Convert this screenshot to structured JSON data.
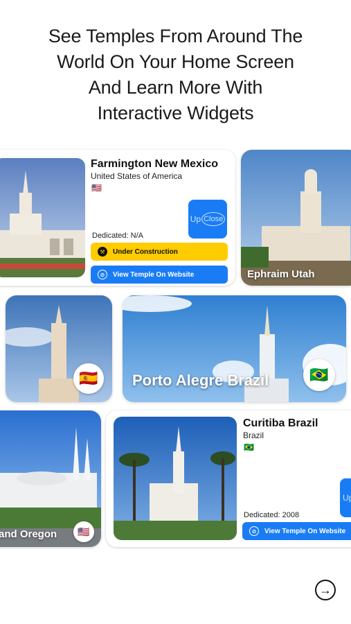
{
  "headline": {
    "line1": "See Temples From Around The",
    "line2": "World On Your Home Screen",
    "line3": "And Learn More With",
    "line4": "Interactive Widgets"
  },
  "widgets": {
    "farmington": {
      "title": "Farmington New Mexico",
      "country": "United States of America",
      "flag": "🇺🇸",
      "upclose_up": "Up",
      "upclose_close": "Close",
      "dedicated": "Dedicated: N/A",
      "status_label": "Under Construction",
      "status_icon": "hammer-icon",
      "website_label": "View Temple On Website",
      "website_icon": "globe-icon"
    },
    "ephraim": {
      "name": "Ephraim Utah"
    },
    "spain": {
      "flag": "🇪🇸"
    },
    "porto_alegre": {
      "name": "Porto Alegre Brazil",
      "flag": "🇧🇷"
    },
    "oregon": {
      "name": "and Oregon",
      "flag": "🇺🇸"
    },
    "curitiba": {
      "title": "Curitiba Brazil",
      "country": "Brazil",
      "flag": "🇧🇷",
      "upclose_up": "Up",
      "dedicated": "Dedicated: 2008",
      "website_label": "View Temple On Website",
      "website_icon": "globe-icon"
    }
  },
  "navigation": {
    "next_icon": "arrow-right-circle-icon",
    "next_glyph": "→"
  },
  "colors": {
    "accent_blue": "#1a7cf5",
    "status_yellow": "#ffcc00",
    "text": "#1a1a1a"
  }
}
